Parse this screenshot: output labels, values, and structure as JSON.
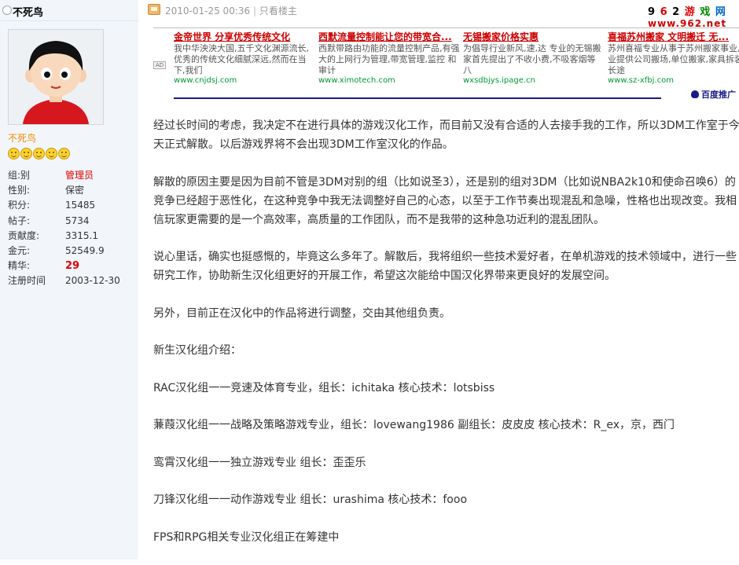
{
  "user": {
    "name": "不死鸟",
    "rank_title": "不死鸟",
    "star_count": 5,
    "fields": [
      {
        "key": "组:别",
        "value": "管理员",
        "style": "red"
      },
      {
        "key": "性别:",
        "value": "保密",
        "style": ""
      },
      {
        "key": "积分:",
        "value": "15485",
        "style": ""
      },
      {
        "key": "帖子:",
        "value": "5734",
        "style": ""
      },
      {
        "key": "贡献度:",
        "value": "3315.1",
        "style": ""
      },
      {
        "key": "金元:",
        "value": "52549.9",
        "style": ""
      },
      {
        "key": "精华:",
        "value": "29",
        "style": "jing"
      },
      {
        "key": "注册时间",
        "value": "2003-12-30",
        "style": ""
      }
    ]
  },
  "post": {
    "datetime": "2010-01-25 00:36",
    "separator": "|",
    "author_only": "只看楼主"
  },
  "logo": {
    "line1": [
      "9",
      "6",
      "2",
      "游",
      "戏",
      "网"
    ],
    "line2": "www.962.net"
  },
  "ad": {
    "badge": "AD",
    "blocks": [
      {
        "title": "金帝世界 分享优秀传统文化",
        "desc": "我中华泱泱大国,五千文化渊源流长,优秀的传统文化细腻深远,然而在当下,我们",
        "url": "www.cnjdsj.com"
      },
      {
        "title": "西默流量控制能让您的带宽合...",
        "desc": "西默带路由功能的流量控制产品,有强大的上网行为管理,带宽管理,监控 和审计",
        "url": "www.ximotech.com"
      },
      {
        "title": "无锡搬家价格实惠",
        "desc": "为倡导行业新风,速,达 专业的无锡搬家首先提出了不收小费,不吸客烟等 八",
        "url": "wxsdbjys.ipage.cn"
      },
      {
        "title": "喜福苏州搬家 文明搬迁 无...",
        "desc": "苏州喜福专业从事于苏州搬家事业,专业提供公司搬场,单位搬家,家具拆装,长途",
        "url": "www.sz-xfbj.com"
      }
    ],
    "provider": "百度推广"
  },
  "content": {
    "paragraphs": [
      [
        "经过长时间的考虑，我决定不在进行具体的游戏汉化工作，而目前又没有合适的人去接手我的工作，所以3DM工作室于今",
        "天正式解散。以后游戏界将不会出现3DM工作室汉化的作品。"
      ],
      [
        "解散的原因主要是因为目前不管是3DM对别的组（比如说圣3），还是别的组对3DM（比如说NBA2k10和使命召唤6）的",
        "竞争已经超于恶性化，在这种竞争中我无法调整好自己的心态，以至于工作节奏出现混乱和急噪，性格也出现改变。我相",
        "信玩家更需要的是一个高效率，高质量的工作团队，而不是我带的这种急功近利的混乱团队。"
      ],
      [
        "说心里话，确实也挺感慨的，毕竟这么多年了。解散后，我将组织一些技术爱好者，在单机游戏的技术领域中，进行一些",
        "研究工作，协助新生汉化组更好的开展工作，希望这次能给中国汉化界带来更良好的发展空间。"
      ],
      [
        "另外，目前正在汉化中的作品将进行调整，交由其他组负责。"
      ],
      [
        "新生汉化组介绍："
      ],
      [
        "RAC汉化组一一竞速及体育专业，组长：ichitaka 核心技术：lotsbiss"
      ],
      [
        "蒹葭汉化组一一战略及策略游戏专业，组长：lovewang1986 副组长：皮皮皮  核心技术：R_ex，京，西门"
      ],
      [
        "鸾霄汉化组一一独立游戏专业  组长：歪歪乐"
      ],
      [
        "刀锋汉化组一一动作游戏专业  组长：urashima 核心技术：fooo"
      ],
      [
        "FPS和RPG相关专业汉化组正在筹建中"
      ]
    ]
  }
}
